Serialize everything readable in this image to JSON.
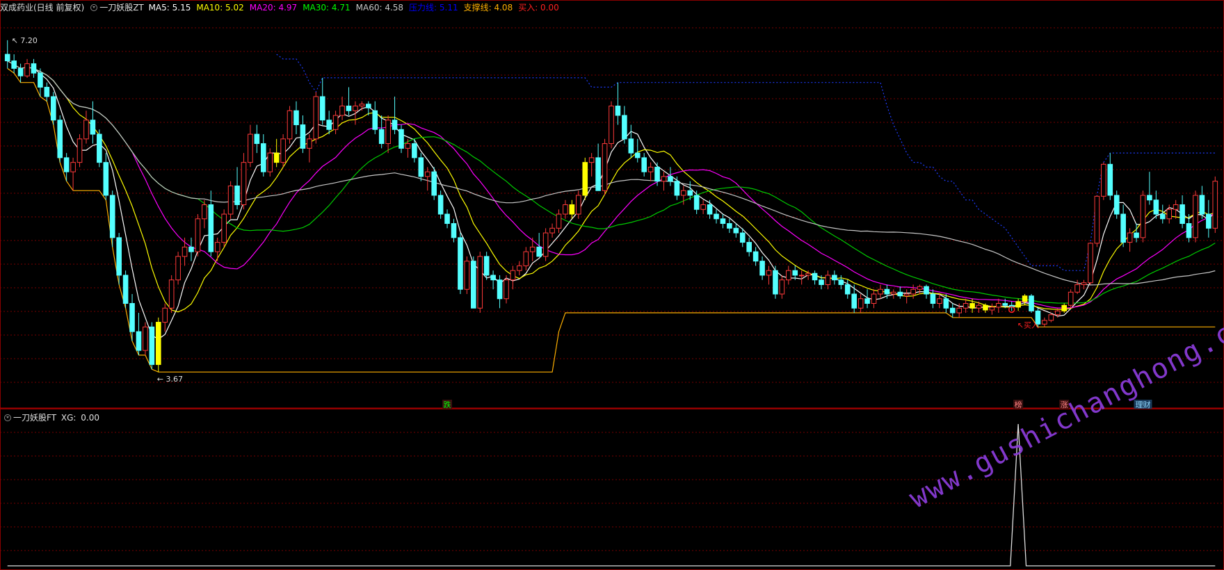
{
  "header": {
    "stock_name": "双成药业(日线 前复权)",
    "indicator_name": "一刀妖股ZT",
    "items": [
      {
        "label": "MA5",
        "value": "5.15",
        "color": "#ffffff"
      },
      {
        "label": "MA10",
        "value": "5.02",
        "color": "#ffff00"
      },
      {
        "label": "MA20",
        "value": "4.97",
        "color": "#ff00ff"
      },
      {
        "label": "MA30",
        "value": "4.71",
        "color": "#00ff00"
      },
      {
        "label": "MA60",
        "value": "4.58",
        "color": "#c8c8c8"
      },
      {
        "label": "压力线",
        "value": "5.11",
        "color": "#0000ff"
      },
      {
        "label": "支撑线",
        "value": "4.08",
        "color": "#ffb000"
      },
      {
        "label": "买入",
        "value": "0.00",
        "color": "#ff2020"
      }
    ]
  },
  "sub_header": {
    "indicator_name": "一刀妖股FT",
    "xg_label": "XG",
    "xg_value": "0.00"
  },
  "watermark": "www.gushichanghong.com",
  "colors": {
    "up": "#ff3a3a",
    "down": "#54ffff",
    "signal": "#ffff00",
    "grid": "#7a0000",
    "ma5": "#ffffff",
    "ma10": "#ffff00",
    "ma20": "#ff00ff",
    "ma30": "#00cc00",
    "ma60": "#c8c8c8",
    "pressure": "#1e3cff",
    "support": "#ffb000"
  },
  "chart_data": {
    "type": "candlestick",
    "title": "双成药业(日线 前复权)",
    "ylim": [
      3.45,
      7.45
    ],
    "price_max_label": "7.20",
    "price_min_label": "3.67",
    "annotations": [
      {
        "label": "跌",
        "bar_index": 67,
        "color": "#00ff00"
      },
      {
        "label": "榜",
        "bar_index": 154,
        "color": "#ff8080"
      },
      {
        "label": "涨",
        "bar_index": 161,
        "color": "#ff8080"
      },
      {
        "label": "理财",
        "bar_index": 173,
        "color": "#8fd8ff"
      },
      {
        "label": "买入",
        "bar_index": 153,
        "color": "#ff2020"
      }
    ],
    "ohlc": [
      [
        7.05,
        7.2,
        6.9,
        6.98
      ],
      [
        6.98,
        7.05,
        6.85,
        6.9
      ],
      [
        6.9,
        6.95,
        6.75,
        6.82
      ],
      [
        6.82,
        7.0,
        6.8,
        6.95
      ],
      [
        6.95,
        7.0,
        6.8,
        6.85
      ],
      [
        6.85,
        6.9,
        6.6,
        6.7
      ],
      [
        6.7,
        6.75,
        6.55,
        6.6
      ],
      [
        6.6,
        6.65,
        6.3,
        6.35
      ],
      [
        6.35,
        6.4,
        5.9,
        5.95
      ],
      [
        5.95,
        6.0,
        5.7,
        5.8
      ],
      [
        5.8,
        5.95,
        5.6,
        5.9
      ],
      [
        5.9,
        6.2,
        5.85,
        6.15
      ],
      [
        6.15,
        6.45,
        6.1,
        6.35
      ],
      [
        6.35,
        6.55,
        6.1,
        6.2
      ],
      [
        6.2,
        6.25,
        5.85,
        5.9
      ],
      [
        5.9,
        6.0,
        5.5,
        5.55
      ],
      [
        5.55,
        5.6,
        5.0,
        5.1
      ],
      [
        5.1,
        5.15,
        4.6,
        4.7
      ],
      [
        4.7,
        4.75,
        4.35,
        4.4
      ],
      [
        4.4,
        4.5,
        4.0,
        4.1
      ],
      [
        4.1,
        4.3,
        3.85,
        3.9
      ],
      [
        3.9,
        4.2,
        3.85,
        4.15
      ],
      [
        4.15,
        4.2,
        3.7,
        3.75
      ],
      [
        3.75,
        4.25,
        3.67,
        4.2
      ],
      [
        4.2,
        4.4,
        4.1,
        4.35
      ],
      [
        4.35,
        4.7,
        4.3,
        4.65
      ],
      [
        4.65,
        4.95,
        4.6,
        4.9
      ],
      [
        4.9,
        5.1,
        4.8,
        5.0
      ],
      [
        5.0,
        5.1,
        4.85,
        4.95
      ],
      [
        4.95,
        5.35,
        4.9,
        5.3
      ],
      [
        5.3,
        5.5,
        5.2,
        5.45
      ],
      [
        5.45,
        5.6,
        4.9,
        4.95
      ],
      [
        4.95,
        5.1,
        4.85,
        5.05
      ],
      [
        5.05,
        5.4,
        5.0,
        5.35
      ],
      [
        5.35,
        5.7,
        5.3,
        5.65
      ],
      [
        5.65,
        5.85,
        5.4,
        5.45
      ],
      [
        5.45,
        6.0,
        5.4,
        5.9
      ],
      [
        5.9,
        6.3,
        5.85,
        6.2
      ],
      [
        6.2,
        6.3,
        6.0,
        6.1
      ],
      [
        6.1,
        6.2,
        5.75,
        5.8
      ],
      [
        5.8,
        6.05,
        5.75,
        6.0
      ],
      [
        6.0,
        6.15,
        5.85,
        5.9
      ],
      [
        5.9,
        6.2,
        5.85,
        6.15
      ],
      [
        6.15,
        6.5,
        6.1,
        6.45
      ],
      [
        6.45,
        6.55,
        6.2,
        6.3
      ],
      [
        6.3,
        6.4,
        6.0,
        6.05
      ],
      [
        6.05,
        6.2,
        5.9,
        6.15
      ],
      [
        6.15,
        6.65,
        6.1,
        6.6
      ],
      [
        6.6,
        6.8,
        6.3,
        6.35
      ],
      [
        6.35,
        6.45,
        6.2,
        6.25
      ],
      [
        6.25,
        6.45,
        6.2,
        6.4
      ],
      [
        6.4,
        6.6,
        6.35,
        6.5
      ],
      [
        6.5,
        6.7,
        6.4,
        6.45
      ],
      [
        6.45,
        6.55,
        6.3,
        6.5
      ],
      [
        6.5,
        6.55,
        6.45,
        6.52
      ],
      [
        6.52,
        6.55,
        6.4,
        6.48
      ],
      [
        6.45,
        6.55,
        6.2,
        6.25
      ],
      [
        6.25,
        6.4,
        6.05,
        6.1
      ],
      [
        6.1,
        6.4,
        6.0,
        6.35
      ],
      [
        6.35,
        6.6,
        6.2,
        6.25
      ],
      [
        6.25,
        6.3,
        6.0,
        6.05
      ],
      [
        6.05,
        6.15,
        5.95,
        6.1
      ],
      [
        6.1,
        6.15,
        5.9,
        5.95
      ],
      [
        5.95,
        6.0,
        5.7,
        5.75
      ],
      [
        5.75,
        5.85,
        5.6,
        5.8
      ],
      [
        5.8,
        5.85,
        5.5,
        5.55
      ],
      [
        5.55,
        5.6,
        5.3,
        5.35
      ],
      [
        5.35,
        5.4,
        5.2,
        5.25
      ],
      [
        5.25,
        5.3,
        5.05,
        5.1
      ],
      [
        5.1,
        5.15,
        4.5,
        4.55
      ],
      [
        4.55,
        4.9,
        4.5,
        4.85
      ],
      [
        4.85,
        4.9,
        4.35,
        4.35
      ],
      [
        4.35,
        4.95,
        4.3,
        4.9
      ],
      [
        4.9,
        4.95,
        4.65,
        4.7
      ],
      [
        4.7,
        4.75,
        4.55,
        4.65
      ],
      [
        4.65,
        4.7,
        4.35,
        4.45
      ],
      [
        4.45,
        4.7,
        4.4,
        4.65
      ],
      [
        4.65,
        4.8,
        4.55,
        4.75
      ],
      [
        4.75,
        4.85,
        4.7,
        4.8
      ],
      [
        4.8,
        5.0,
        4.75,
        4.95
      ],
      [
        4.95,
        5.1,
        4.85,
        5.0
      ],
      [
        5.0,
        5.15,
        4.9,
        4.9
      ],
      [
        4.9,
        5.2,
        4.85,
        5.15
      ],
      [
        5.15,
        5.25,
        5.1,
        5.2
      ],
      [
        5.2,
        5.4,
        5.15,
        5.35
      ],
      [
        5.35,
        5.5,
        5.3,
        5.45
      ],
      [
        5.45,
        5.5,
        5.3,
        5.35
      ],
      [
        5.35,
        5.6,
        5.3,
        5.55
      ],
      [
        5.55,
        5.95,
        5.5,
        5.9
      ],
      [
        5.9,
        6.0,
        5.75,
        5.95
      ],
      [
        5.95,
        6.1,
        5.6,
        5.6
      ],
      [
        5.6,
        6.15,
        5.55,
        6.1
      ],
      [
        6.1,
        6.55,
        6.05,
        6.5
      ],
      [
        6.5,
        6.75,
        6.3,
        6.4
      ],
      [
        6.4,
        6.5,
        6.1,
        6.15
      ],
      [
        6.15,
        6.3,
        5.95,
        6.0
      ],
      [
        6.0,
        6.15,
        5.9,
        5.95
      ],
      [
        5.95,
        6.0,
        5.75,
        5.8
      ],
      [
        5.8,
        5.9,
        5.7,
        5.85
      ],
      [
        5.85,
        5.9,
        5.65,
        5.7
      ],
      [
        5.7,
        5.8,
        5.6,
        5.75
      ],
      [
        5.75,
        5.85,
        5.65,
        5.7
      ],
      [
        5.7,
        5.75,
        5.5,
        5.55
      ],
      [
        5.55,
        5.65,
        5.45,
        5.6
      ],
      [
        5.6,
        5.7,
        5.5,
        5.55
      ],
      [
        5.55,
        5.6,
        5.35,
        5.4
      ],
      [
        5.4,
        5.5,
        5.35,
        5.45
      ],
      [
        5.45,
        5.5,
        5.3,
        5.35
      ],
      [
        5.35,
        5.4,
        5.25,
        5.3
      ],
      [
        5.3,
        5.35,
        5.2,
        5.25
      ],
      [
        5.25,
        5.3,
        5.15,
        5.2
      ],
      [
        5.2,
        5.25,
        5.1,
        5.15
      ],
      [
        5.15,
        5.2,
        5.0,
        5.05
      ],
      [
        5.05,
        5.1,
        4.9,
        4.95
      ],
      [
        4.95,
        5.0,
        4.8,
        4.85
      ],
      [
        4.85,
        4.9,
        4.65,
        4.7
      ],
      [
        4.7,
        4.8,
        4.6,
        4.75
      ],
      [
        4.75,
        4.8,
        4.45,
        4.5
      ],
      [
        4.5,
        4.7,
        4.45,
        4.65
      ],
      [
        4.65,
        4.8,
        4.6,
        4.75
      ],
      [
        4.75,
        4.8,
        4.65,
        4.7
      ],
      [
        4.7,
        4.75,
        4.6,
        4.7
      ],
      [
        4.7,
        4.75,
        4.65,
        4.72
      ],
      [
        4.72,
        4.75,
        4.6,
        4.65
      ],
      [
        4.65,
        4.7,
        4.55,
        4.6
      ],
      [
        4.6,
        4.75,
        4.55,
        4.7
      ],
      [
        4.7,
        4.75,
        4.6,
        4.65
      ],
      [
        4.65,
        4.7,
        4.55,
        4.6
      ],
      [
        4.6,
        4.65,
        4.45,
        4.5
      ],
      [
        4.5,
        4.6,
        4.3,
        4.35
      ],
      [
        4.35,
        4.5,
        4.3,
        4.45
      ],
      [
        4.45,
        4.55,
        4.35,
        4.4
      ],
      [
        4.4,
        4.55,
        4.35,
        4.5
      ],
      [
        4.5,
        4.6,
        4.45,
        4.55
      ],
      [
        4.55,
        4.6,
        4.45,
        4.5
      ],
      [
        4.5,
        4.55,
        4.45,
        4.52
      ],
      [
        4.52,
        4.58,
        4.45,
        4.48
      ],
      [
        4.48,
        4.55,
        4.4,
        4.5
      ],
      [
        4.5,
        4.6,
        4.45,
        4.55
      ],
      [
        4.55,
        4.6,
        4.5,
        4.58
      ],
      [
        4.58,
        4.6,
        4.45,
        4.5
      ],
      [
        4.5,
        4.55,
        4.35,
        4.4
      ],
      [
        4.4,
        4.5,
        4.35,
        4.45
      ],
      [
        4.45,
        4.5,
        4.3,
        4.35
      ],
      [
        4.35,
        4.4,
        4.25,
        4.3
      ],
      [
        4.3,
        4.4,
        4.25,
        4.35
      ],
      [
        4.35,
        4.45,
        4.3,
        4.4
      ],
      [
        4.4,
        4.45,
        4.3,
        4.35
      ],
      [
        4.35,
        4.42,
        4.3,
        4.38
      ],
      [
        4.38,
        4.4,
        4.3,
        4.33
      ],
      [
        4.33,
        4.4,
        4.28,
        4.36
      ],
      [
        4.36,
        4.45,
        4.3,
        4.4
      ],
      [
        4.4,
        4.45,
        4.35,
        4.38
      ],
      [
        4.38,
        4.42,
        4.32,
        4.36
      ],
      [
        4.36,
        4.45,
        4.32,
        4.42
      ],
      [
        4.42,
        4.5,
        4.38,
        4.48
      ],
      [
        4.48,
        4.5,
        4.3,
        4.32
      ],
      [
        4.32,
        4.35,
        4.15,
        4.18
      ],
      [
        4.18,
        4.25,
        4.15,
        4.22
      ],
      [
        4.22,
        4.3,
        4.2,
        4.28
      ],
      [
        4.28,
        4.35,
        4.25,
        4.32
      ],
      [
        4.32,
        4.4,
        4.3,
        4.38
      ],
      [
        4.38,
        4.55,
        4.35,
        4.52
      ],
      [
        4.52,
        4.65,
        4.5,
        4.6
      ],
      [
        4.6,
        4.65,
        4.55,
        4.62
      ],
      [
        4.62,
        5.05,
        4.6,
        5.04
      ],
      [
        5.04,
        5.55,
        5.0,
        5.54
      ],
      [
        5.54,
        5.9,
        5.5,
        5.88
      ],
      [
        5.88,
        6.0,
        5.5,
        5.55
      ],
      [
        5.55,
        5.6,
        5.3,
        5.35
      ],
      [
        5.35,
        5.45,
        5.0,
        5.05
      ],
      [
        5.05,
        5.2,
        4.95,
        5.15
      ],
      [
        5.15,
        5.25,
        5.05,
        5.1
      ],
      [
        5.1,
        5.6,
        5.05,
        5.55
      ],
      [
        5.55,
        5.8,
        5.45,
        5.5
      ],
      [
        5.5,
        5.6,
        5.3,
        5.35
      ],
      [
        5.35,
        5.45,
        5.25,
        5.3
      ],
      [
        5.3,
        5.45,
        5.25,
        5.4
      ],
      [
        5.4,
        5.5,
        5.3,
        5.45
      ],
      [
        5.45,
        5.55,
        5.2,
        5.25
      ],
      [
        5.25,
        5.35,
        5.05,
        5.1
      ],
      [
        5.1,
        5.6,
        5.05,
        5.55
      ],
      [
        5.55,
        5.65,
        5.3,
        5.35
      ],
      [
        5.35,
        5.5,
        5.1,
        5.2
      ],
      [
        5.2,
        5.75,
        5.15,
        5.7
      ]
    ],
    "signal_bars": [
      23,
      41,
      86,
      88,
      147,
      149,
      154,
      155,
      161
    ],
    "buy_markers": [
      153
    ],
    "sub_indicator": {
      "name": "一刀妖股FT",
      "series": "XG",
      "ylim": [
        0,
        1
      ],
      "spikes": [
        {
          "index": 154,
          "value": 1
        }
      ]
    }
  }
}
